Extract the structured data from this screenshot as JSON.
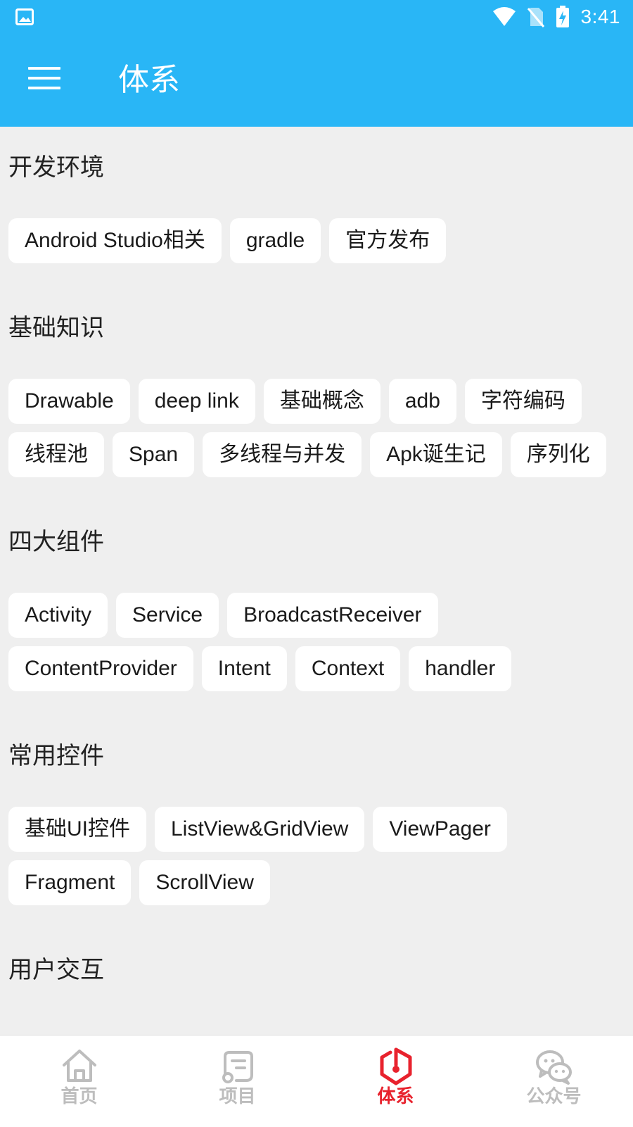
{
  "status_bar": {
    "time": "3:41"
  },
  "app_bar": {
    "title": "体系"
  },
  "sections": [
    {
      "title": "开发环境",
      "chips": [
        "Android Studio相关",
        "gradle",
        "官方发布"
      ]
    },
    {
      "title": "基础知识",
      "chips": [
        "Drawable",
        "deep link",
        "基础概念",
        "adb",
        "字符编码",
        "线程池",
        "Span",
        "多线程与并发",
        "Apk诞生记",
        "序列化"
      ]
    },
    {
      "title": "四大组件",
      "chips": [
        "Activity",
        "Service",
        "BroadcastReceiver",
        "ContentProvider",
        "Intent",
        "Context",
        "handler"
      ]
    },
    {
      "title": "常用控件",
      "chips": [
        "基础UI控件",
        "ListView&GridView",
        "ViewPager",
        "Fragment",
        "ScrollView"
      ]
    },
    {
      "title": "用户交互",
      "chips": []
    }
  ],
  "bottom_nav": {
    "items": [
      {
        "label": "首页",
        "icon": "home-icon"
      },
      {
        "label": "项目",
        "icon": "project-icon"
      },
      {
        "label": "体系",
        "icon": "system-icon",
        "active": true
      },
      {
        "label": "公众号",
        "icon": "wechat-icon"
      }
    ]
  },
  "colors": {
    "primary": "#29b6f6",
    "accent": "#e8222d",
    "inactive": "#bdbdbd",
    "background": "#efefef"
  }
}
